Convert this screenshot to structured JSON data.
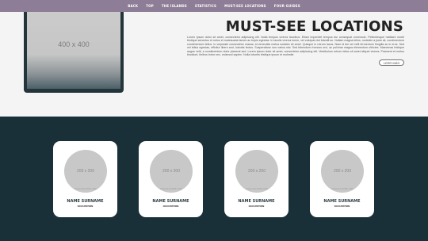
{
  "nav": {
    "items": [
      "BACK",
      "TOP",
      "THE ISLANDS",
      "STATISTICS",
      "MUST-SEE LOCATIONS",
      "FOUR GUIDES"
    ]
  },
  "hero": {
    "image_label": "400 x 400",
    "image_credit": "Powered by HTML.COM",
    "title": "MUST-SEE LOCATIONS",
    "body": "Lorem ipsum dolor sit amet, consectetur adipiscing elit. Nulla tempus viverra faucibus. Etiam imperdiet tempus dui consequat commodo. Pellentesque habitant morbi tristique senectus et netus et malesuada fames ac turpis egestas. In iaculis viverra lorem, vel volutpat nisl blandit ac. Nullam magna tellus, molestie a justo sit, condimentum condimentum tellus. In vulputate consectetur massa, id venenatis metus sodales sit amet. Quisque in rutrum lacus. Nam id dui vel velit fermentum fringilla ac in eros. Sed vel tellus egestas, efficitur libero sed, lobortis lectus. Suspendisse non varius nisi. Sed bibendum rhoncus orci, ac pulvinar magna elementum ultricies. Maecenas tristique augue velit, a condimentum dolor placerat sed. Lorem ipsum dolor sit amet, consectetur adipiscing elit. Vestibulum rutrum tellus sit amet aliquet viverra. Praesent et metus tincidunt, finibus tortor nec, euismod sapien. Nulla lobortis tristique ipsum et molestie.",
    "more_label": "LEER MÁS"
  },
  "team": {
    "avatar_label": "200 x 200",
    "avatar_credit": "Powered by HTML.COM",
    "members": [
      {
        "name": "NAME SURNAME",
        "occupation": "OCCUPATION"
      },
      {
        "name": "NAME SURNAME",
        "occupation": "OCCUPATION"
      },
      {
        "name": "NAME SURNAME",
        "occupation": "OCCUPATION"
      },
      {
        "name": "NAME SURNAME",
        "occupation": "OCCUPATION"
      }
    ]
  },
  "colors": {
    "nav_bg": "#8e7d96",
    "team_bg": "#1a3038",
    "page_bg": "#f4f4f4"
  }
}
